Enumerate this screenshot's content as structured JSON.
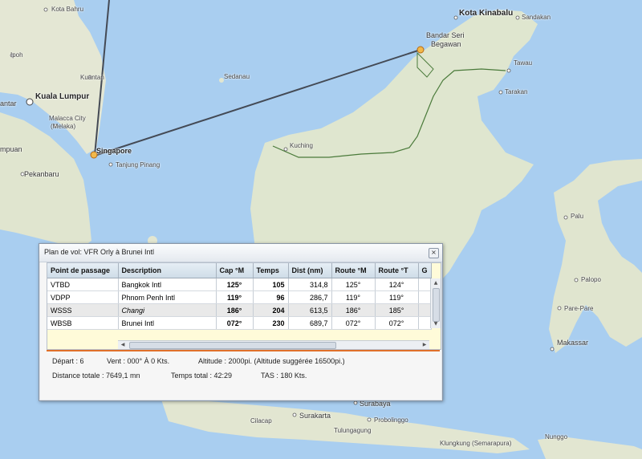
{
  "map": {
    "labels": [
      {
        "name": "kota-bahru",
        "text": "Kota Bahru"
      },
      {
        "name": "ipoh",
        "text": "Ipoh"
      },
      {
        "name": "kuantan",
        "text": "Kuantan"
      },
      {
        "name": "kuala-lumpur",
        "text": "Kuala Lumpur"
      },
      {
        "name": "antar",
        "text": "antar"
      },
      {
        "name": "malacca",
        "text": "Malacca City"
      },
      {
        "name": "melaka",
        "text": "(Melaka)"
      },
      {
        "name": "singapore",
        "text": "Singapore"
      },
      {
        "name": "tanjung-pinang",
        "text": "Tanjung Pinang"
      },
      {
        "name": "mpuan",
        "text": "mpuan"
      },
      {
        "name": "pekanbaru",
        "text": "Pekanbaru"
      },
      {
        "name": "sedanau",
        "text": "Sedanau"
      },
      {
        "name": "kuching",
        "text": "Kuching"
      },
      {
        "name": "kota-kinabalu",
        "text": "Kota Kinabalu"
      },
      {
        "name": "sandakan",
        "text": "Sandakan"
      },
      {
        "name": "bandar-seri",
        "text": "Bandar Seri"
      },
      {
        "name": "begawan",
        "text": "Begawan"
      },
      {
        "name": "tawau",
        "text": "Tawau"
      },
      {
        "name": "tarakan",
        "text": "Tarakan"
      },
      {
        "name": "palu",
        "text": "Palu"
      },
      {
        "name": "palopo",
        "text": "Palopo"
      },
      {
        "name": "pare-pare",
        "text": "Pare-Pare"
      },
      {
        "name": "makassar",
        "text": "Makassar"
      },
      {
        "name": "surabaya",
        "text": "Surabaya"
      },
      {
        "name": "surakarta",
        "text": "Surakarta"
      },
      {
        "name": "cilacap",
        "text": "Cilacap"
      },
      {
        "name": "probolinggo",
        "text": "Probolinggo"
      },
      {
        "name": "tulungagung",
        "text": "Tulungagung"
      },
      {
        "name": "nunggo",
        "text": "Nunggo"
      },
      {
        "name": "klungkung",
        "text": "Klungkung (Semarapura)"
      }
    ]
  },
  "flight_plan": {
    "title": "Plan de vol: VFR Orly à Brunei Intl",
    "close_label": "×",
    "columns": [
      "Point de passage",
      "Description",
      "Cap °M",
      "Temps",
      "Dist (nm)",
      "Route °M",
      "Route °T",
      "G"
    ],
    "rows": [
      {
        "point": "VTBD",
        "description": "Bangkok Intl",
        "cap": "125°",
        "temps": "105",
        "dist": "314,8",
        "route_m": "125°",
        "route_t": "124°"
      },
      {
        "point": "VDPP",
        "description": "Phnom Penh Intl",
        "cap": "119°",
        "temps": "96",
        "dist": "286,7",
        "route_m": "119°",
        "route_t": "119°"
      },
      {
        "point": "WSSS",
        "description": "Changi",
        "cap": "186°",
        "temps": "204",
        "dist": "613,5",
        "route_m": "186°",
        "route_t": "185°"
      },
      {
        "point": "WBSB",
        "description": "Brunei Intl",
        "cap": "072°",
        "temps": "230",
        "dist": "689,7",
        "route_m": "072°",
        "route_t": "072°"
      }
    ],
    "info": {
      "depart": "Départ :  6",
      "vent": "Vent :  000° À 0 Kts.",
      "altitude": "Altitude :  2000pi. (Altitude suggérée 16500pi.)",
      "distance": "Distance totale :  7649,1 mn",
      "temps_total": "Temps total :  42:29",
      "tas": "TAS :  180 Kts."
    }
  }
}
